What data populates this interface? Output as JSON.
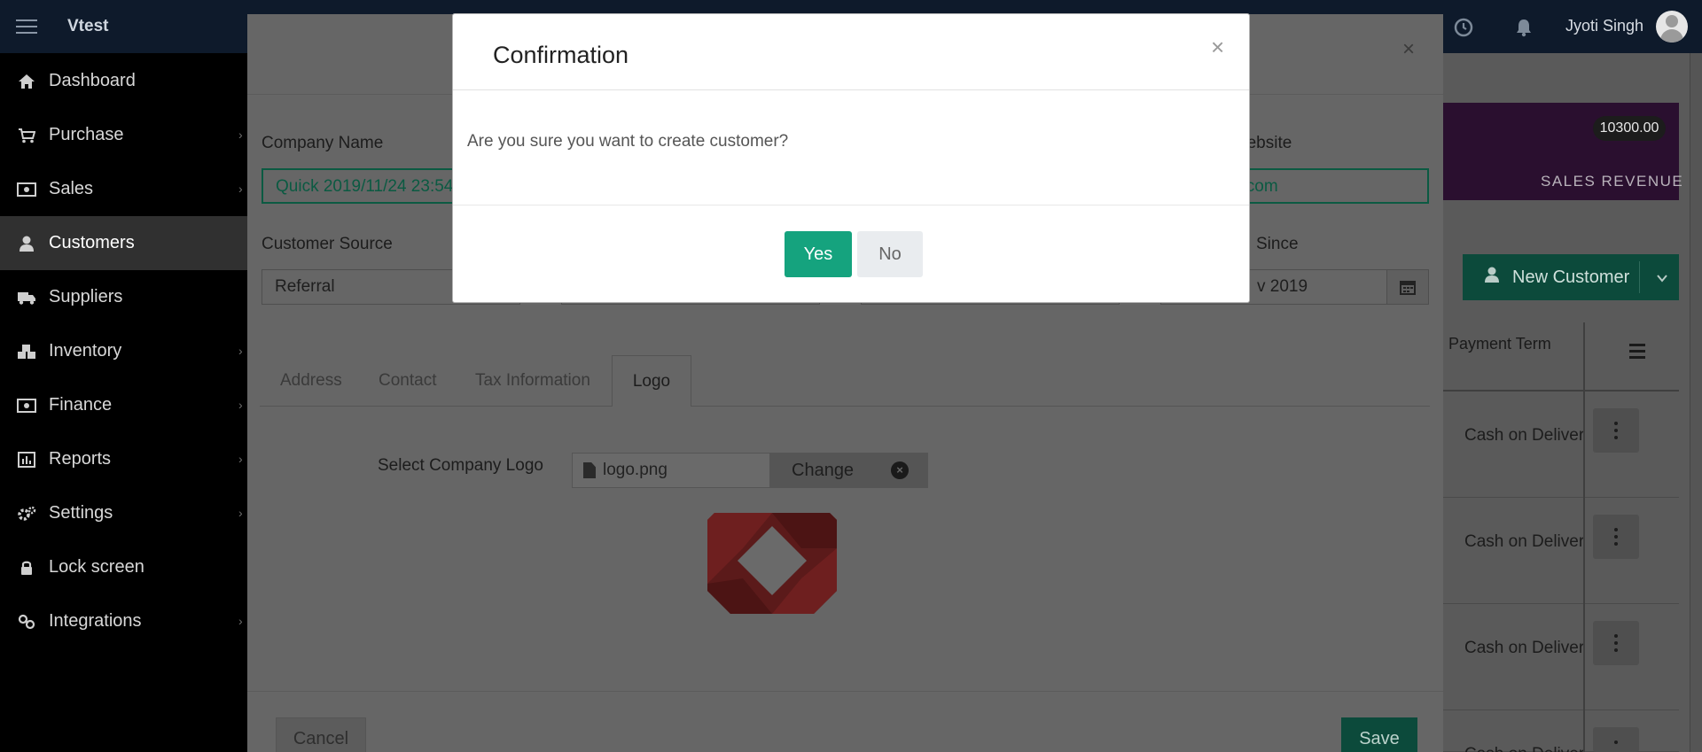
{
  "app": {
    "name": "Vtest"
  },
  "user": {
    "name": "Jyoti Singh"
  },
  "sidebar": {
    "items": [
      {
        "label": "Dashboard",
        "icon": "home-icon",
        "has_children": false
      },
      {
        "label": "Purchase",
        "icon": "cart-icon",
        "has_children": true
      },
      {
        "label": "Sales",
        "icon": "money-icon",
        "has_children": true
      },
      {
        "label": "Customers",
        "icon": "user-icon",
        "has_children": false,
        "active": true
      },
      {
        "label": "Suppliers",
        "icon": "truck-icon",
        "has_children": false
      },
      {
        "label": "Inventory",
        "icon": "cubes-icon",
        "has_children": true
      },
      {
        "label": "Finance",
        "icon": "money-icon",
        "has_children": true
      },
      {
        "label": "Reports",
        "icon": "bar-chart-icon",
        "has_children": true
      },
      {
        "label": "Settings",
        "icon": "gears-icon",
        "has_children": true
      },
      {
        "label": "Lock screen",
        "icon": "lock-icon",
        "has_children": false
      },
      {
        "label": "Integrations",
        "icon": "link-icon",
        "has_children": true
      }
    ]
  },
  "summary_card": {
    "value": "10300.00",
    "label": "SALES REVENUE"
  },
  "new_customer_button": {
    "label": "New Customer"
  },
  "table": {
    "header": {
      "payment_term": "Payment Term"
    },
    "rows": [
      {
        "payment_term": "Cash on Delivery"
      },
      {
        "payment_term": "Cash on Delivery"
      },
      {
        "payment_term": "Cash on Delivery"
      },
      {
        "payment_term": "Cash on Delivery"
      }
    ]
  },
  "customer_form": {
    "company_name": {
      "label": "Company Name",
      "value": "Quick 2019/11/24 23:54"
    },
    "website": {
      "label": "Website",
      "value": "c.com"
    },
    "customer_source": {
      "label": "Customer Source",
      "value": "Referral"
    },
    "customer_since": {
      "label": "Since",
      "value": "v 2019"
    },
    "tabs": [
      "Address",
      "Contact",
      "Tax Information",
      "Logo"
    ],
    "active_tab": "Logo",
    "logo": {
      "label": "Select Company Logo",
      "file_name": "logo.png",
      "change_label": "Change"
    },
    "cancel_label": "Cancel",
    "save_label": "Save"
  },
  "confirmation": {
    "title": "Confirmation",
    "message": "Are you sure you want to create customer?",
    "yes_label": "Yes",
    "no_label": "No",
    "close_symbol": "×"
  },
  "colors": {
    "primary": "#15a37e",
    "topbar": "#0e1a2b",
    "sidebar": "#000000",
    "dialog_bg": "#ffffff"
  }
}
